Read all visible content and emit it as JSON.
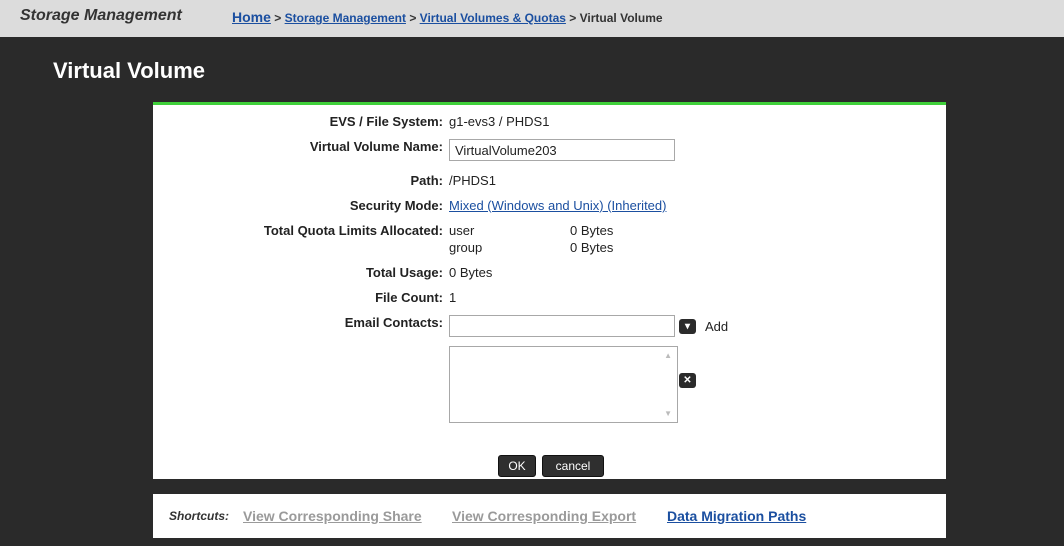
{
  "header": {
    "section": "Storage Management",
    "breadcrumb": {
      "home": "Home",
      "items": [
        "Storage Management",
        "Virtual Volumes & Quotas"
      ],
      "current": "Virtual Volume",
      "separator": ">"
    }
  },
  "page_title": "Virtual Volume",
  "form": {
    "evs": {
      "label": "EVS / File System:",
      "value": "g1-evs3 /  PHDS1"
    },
    "name": {
      "label": "Virtual Volume Name:",
      "value": "VirtualVolume203"
    },
    "path": {
      "label": "Path:",
      "value": "/PHDS1"
    },
    "security": {
      "label": "Security Mode:",
      "value": "Mixed (Windows and Unix) (Inherited)"
    },
    "quota": {
      "label": "Total Quota Limits Allocated:",
      "rows": [
        {
          "type": "user",
          "amount": "0 Bytes"
        },
        {
          "type": "group",
          "amount": "0 Bytes"
        }
      ]
    },
    "usage": {
      "label": "Total Usage:",
      "value": "0 Bytes"
    },
    "file_count": {
      "label": "File Count:",
      "value": "1"
    },
    "email": {
      "label": "Email Contacts:",
      "value": "",
      "add_label": "Add"
    },
    "buttons": {
      "ok": "OK",
      "cancel": "cancel"
    }
  },
  "shortcuts": {
    "label": "Shortcuts:",
    "links": [
      "View Corresponding Share",
      "View Corresponding Export",
      "Data Migration Paths"
    ]
  },
  "colors": {
    "accent": "#3fd03a",
    "link": "#1b4fa0",
    "background": "#2a2a2a"
  }
}
